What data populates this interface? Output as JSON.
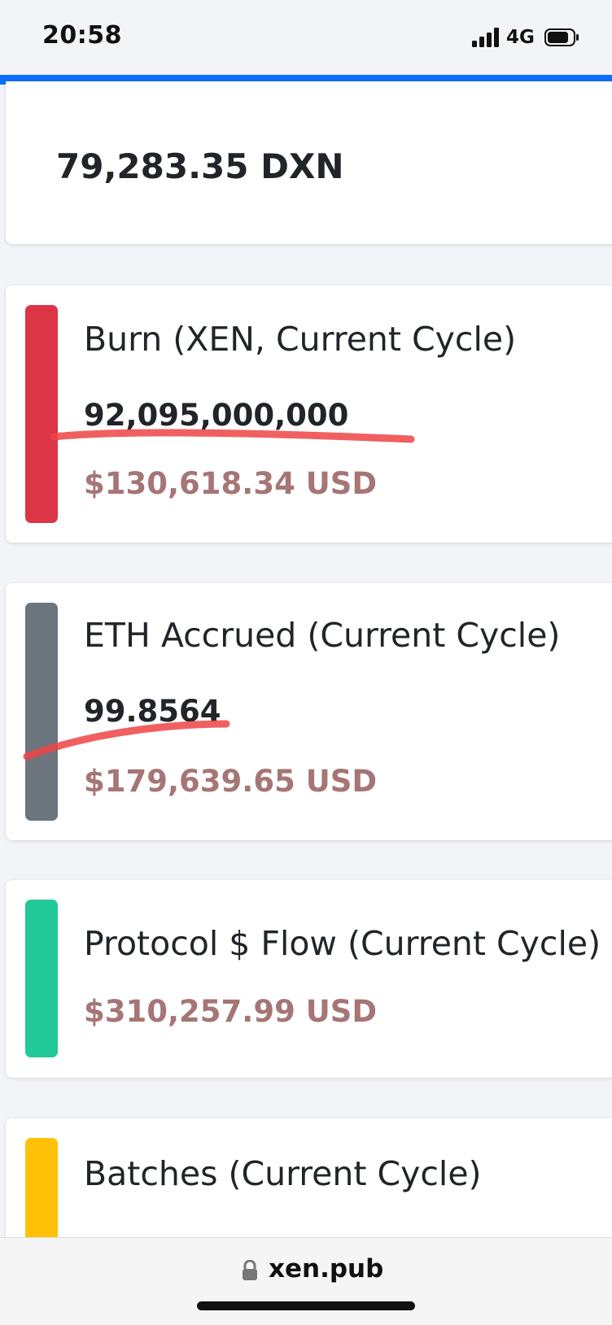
{
  "status_bar": {
    "time": "20:58",
    "network": "4G",
    "icons": [
      "signal-icon",
      "battery-icon"
    ]
  },
  "colors": {
    "accent": "#0d6efd",
    "burn": "#dc3545",
    "eth": "#6c757d",
    "flow": "#20c997",
    "batches": "#ffc107",
    "usd_text": "#a67575",
    "annotation": "#ef4444"
  },
  "balance": {
    "value": "79,283.35 DXN"
  },
  "stats": {
    "burn": {
      "title": "Burn (XEN, Current Cycle)",
      "value": "92,095,000,000",
      "usd": "$130,618.34 USD"
    },
    "eth": {
      "title": "ETH Accrued (Current Cycle)",
      "value": "99.8564",
      "usd": "$179,639.65 USD"
    },
    "flow": {
      "title": "Protocol $ Flow (Current Cycle)",
      "usd": "$310,257.99 USD"
    },
    "batches": {
      "title": "Batches (Current Cycle)"
    }
  },
  "browser": {
    "url": "xen.pub",
    "icon": "lock-icon"
  }
}
